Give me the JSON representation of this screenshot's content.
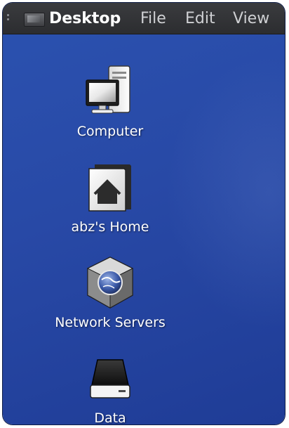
{
  "menubar": {
    "title": "Desktop",
    "items": [
      "File",
      "Edit",
      "View"
    ]
  },
  "desktop": {
    "icons": [
      {
        "label": "Computer",
        "icon": "computer-icon"
      },
      {
        "label": "abz's Home",
        "icon": "home-folder-icon"
      },
      {
        "label": "Network Servers",
        "icon": "network-servers-icon"
      },
      {
        "label": "Data",
        "icon": "drive-icon"
      }
    ]
  },
  "colors": {
    "desktop_background": "#2849a6",
    "menubar_background": "#2f3033",
    "label_text": "#ffffff"
  }
}
